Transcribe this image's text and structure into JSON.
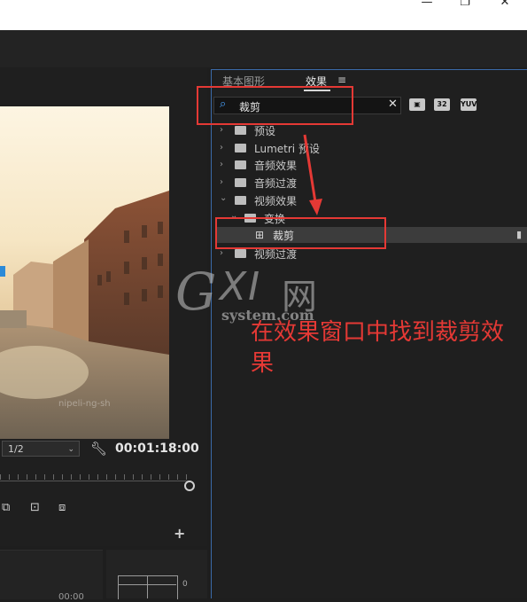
{
  "window": {
    "minimize_glyph": "—",
    "restore_glyph": "❐",
    "close_glyph": "✕"
  },
  "monitor": {
    "scale_value": "1/2",
    "timecode": "00:01:18:00",
    "video_watermark": "nipeli-ng-sh"
  },
  "panel": {
    "tabs": [
      {
        "label": "基本图形",
        "active": false
      },
      {
        "label": "效果",
        "active": true
      }
    ],
    "menu_glyph": "≡",
    "search": {
      "value": "裁剪"
    },
    "badges": [
      "32",
      "YUV"
    ],
    "tree": [
      {
        "label": "预设",
        "expanded": false,
        "level": 0
      },
      {
        "label": "Lumetri 预设",
        "expanded": false,
        "level": 0
      },
      {
        "label": "音频效果",
        "expanded": false,
        "level": 0
      },
      {
        "label": "音频过渡",
        "expanded": false,
        "level": 0
      },
      {
        "label": "视频效果",
        "expanded": true,
        "level": 0
      },
      {
        "label": "变换",
        "expanded": true,
        "level": 1
      },
      {
        "label": "裁剪",
        "expanded": false,
        "level": 2,
        "selected": true
      },
      {
        "label": "视频过渡",
        "expanded": false,
        "level": 0
      }
    ]
  },
  "annotation": {
    "text": "在效果窗口中找到裁剪效果"
  },
  "watermark": {
    "big": "G X I 网",
    "g": "G",
    "xi": "XI",
    "net": "网",
    "small": "system.com"
  },
  "colors": {
    "highlight_red": "#e53935",
    "panel_border_blue": "#3b6aa8",
    "search_icon_blue": "#4aa3ff"
  }
}
